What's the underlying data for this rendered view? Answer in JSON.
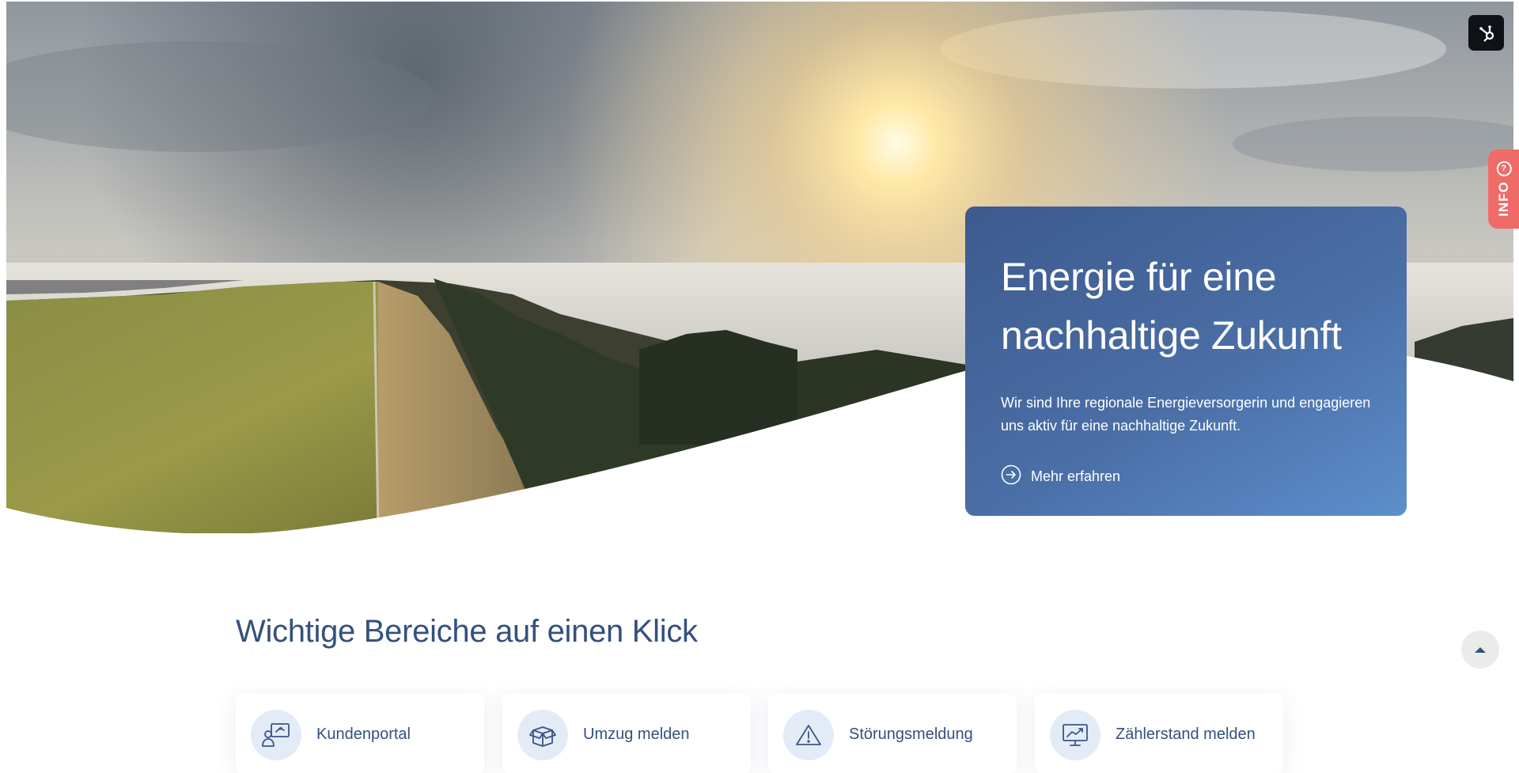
{
  "hero": {
    "title": "Energie für eine nachhaltige Zukunft",
    "text": "Wir sind Ihre regionale Energieversorgerin und engagieren uns aktiv für eine nachhaltige Zukunft.",
    "link_label": "Mehr erfahren"
  },
  "side_tab": {
    "label": "INFO",
    "icon": "question-icon"
  },
  "widget": {
    "icon": "hubspot-icon"
  },
  "quicklinks": {
    "title": "Wichtige Bereiche auf einen Klick",
    "items": [
      {
        "label": "Kundenportal",
        "icon": "customer-portal-icon"
      },
      {
        "label": "Umzug melden",
        "icon": "moving-box-icon"
      },
      {
        "label": "Störungsmeldung",
        "icon": "warning-icon"
      },
      {
        "label": "Zählerstand melden",
        "icon": "meter-reading-icon"
      }
    ]
  },
  "scroll_top": {
    "icon": "chevron-up-icon"
  },
  "colors": {
    "primary": "#34507e",
    "card_gradient_start": "#3d5a8d",
    "card_gradient_end": "#5c8fcb",
    "info_tab": "#ef6b67",
    "icon_circle": "#e3ecf6"
  }
}
